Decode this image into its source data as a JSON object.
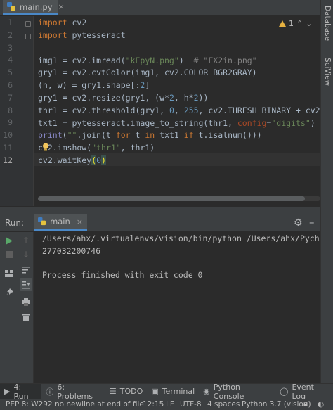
{
  "editor_tab": {
    "label": "main.py",
    "close": "×"
  },
  "right_strip": {
    "database": "Database",
    "sciview": "SciView"
  },
  "editor": {
    "warnings": "1",
    "nav_up": "⌃",
    "nav_down": "⌄",
    "line_numbers": [
      "1",
      "2",
      "3",
      "4",
      "5",
      "6",
      "7",
      "8",
      "9",
      "10",
      "11",
      "12"
    ]
  },
  "run_panel": {
    "title": "Run:",
    "tab_label": "main",
    "tab_close": "×",
    "console": [
      "/Users/ahx/.virtualenvs/vision/bin/python /Users/ahx/Pycha",
      "277032200746",
      "",
      "Process finished with exit code 0"
    ]
  },
  "bottom_tools": [
    {
      "icon": "run-icon",
      "label": "4: Run"
    },
    {
      "icon": "problems-icon",
      "label": "6: Problems"
    },
    {
      "icon": "todo-icon",
      "label": "TODO"
    },
    {
      "icon": "terminal-icon",
      "label": "Terminal"
    },
    {
      "icon": "python-console-icon",
      "label": "Python Console"
    },
    {
      "icon": "event-log-icon",
      "label": "Event Log"
    }
  ],
  "status_bar": {
    "message": "PEP 8: W292 no newline at end of file",
    "position": "12:15",
    "line_sep": "LF",
    "encoding": "UTF-8",
    "indent": "4 spaces",
    "interpreter": "Python 3.7 (vision)"
  },
  "colors": {
    "accent": "#4a88c7",
    "keyword": "#cc7832",
    "string": "#6a8759",
    "number": "#6897bb"
  }
}
